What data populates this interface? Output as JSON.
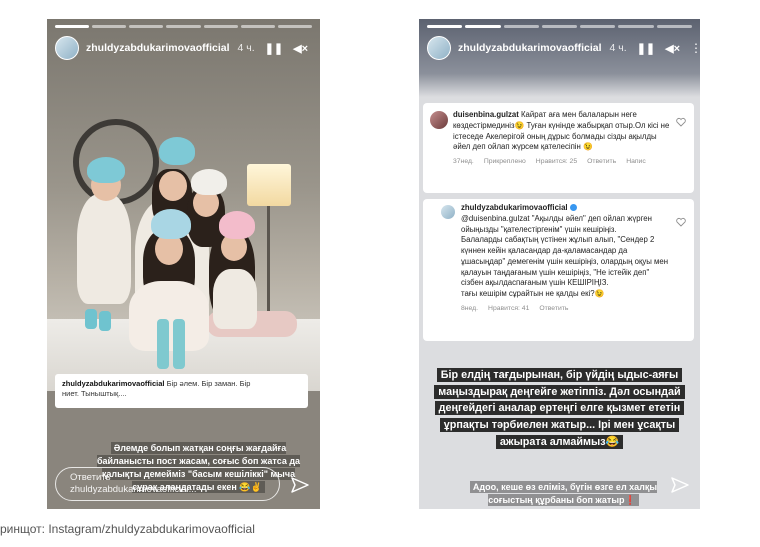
{
  "story_left": {
    "username": "zhuldyzabdukarimovaofficial",
    "age": "4 ч.",
    "caption_user": "zhuldyzabdukarimovaofficial",
    "caption_text": "Бір әлем. Бір заман. Бір\nниет. Тыныштық....",
    "overlay_text": "Әлемде болып жатқан соңғы жағдайға\nбайланысты пост жасам, соғыс боп жатса да\nқалықты демейміз \"басым кешіліккі\" мыча\nсұрақ алаңдатады екен 😂✌",
    "reply_text": "Ответить\nzhuldyzabdukarimovaofficial...",
    "progress_total": 7,
    "progress_done": 1
  },
  "story_right": {
    "username": "zhuldyzabdukarimovaofficial",
    "age": "4 ч.",
    "progress_total": 7,
    "progress_done": 2,
    "comment1": {
      "user": "duisenbina.gulzat",
      "text": "Кайрат аға мен балаларын неге көздестірмединіз😉 Туған күнінде жабырқап отыр.Ол кісі не істеседе Акелерігой оның дұрыс болмады сізды ақылды әйел деп ойлап жүрсем қателесіпін 😉",
      "time": "37нед.",
      "pinned": "Прикреплено",
      "likes": "Нравится: 25",
      "reply": "Ответить",
      "write": "Напис"
    },
    "comment2": {
      "user": "zhuldyzabdukarimovaofficial",
      "text": "@duisenbina.gulzat \"Ақылды әйел\" деп ойлап жүрген ойыңызды \"қателестіргенім\" үшін кешіріңіз.\nБалаларды сабақтың үстінен жұлып алып, \"Сендер 2 күннен кейін қаласандар да-қаламасандар да ұшасыңдар\" демегенім үшін кешіріңіз, олардың оқуы мен қалауын таңдағаным үшін кешіріңіз, \"Не істейік деп\" сізбен ақылдаспағаным үшін КЕШІРІҢІЗ.\nтағы кешірім сұрайтын не қалды екі?😉",
      "time": "8нед.",
      "likes": "Нравится: 41",
      "reply": "Ответить"
    },
    "black_text": "Бір елдің тағдырынан, бір үйдің ыдыс-аяғы\nмаңыздырақ деңгейге жетіппіз. Дәл осындай\nдеңгейдегі аналар ертеңгі елге қызмет ететін\nұрпақты тәрбиелен жатыр... Ірі мен ұсақты\nажырата алмаймыз😂",
    "overlay_text": "Адоо, кеше өз еліміз, бүгін өзге ел халқы\nсоғыстың құрбаны боп жатыр❗"
  },
  "page_caption": "ринщот: Instagram/zhuldyzabdukarimovaofficial",
  "icons": [
    "pause-icon",
    "mute-icon",
    "more-icon",
    "send-icon",
    "heart-icon"
  ],
  "colors": {
    "verified": "#3897f0",
    "text_bg": "#2c2c2c"
  }
}
